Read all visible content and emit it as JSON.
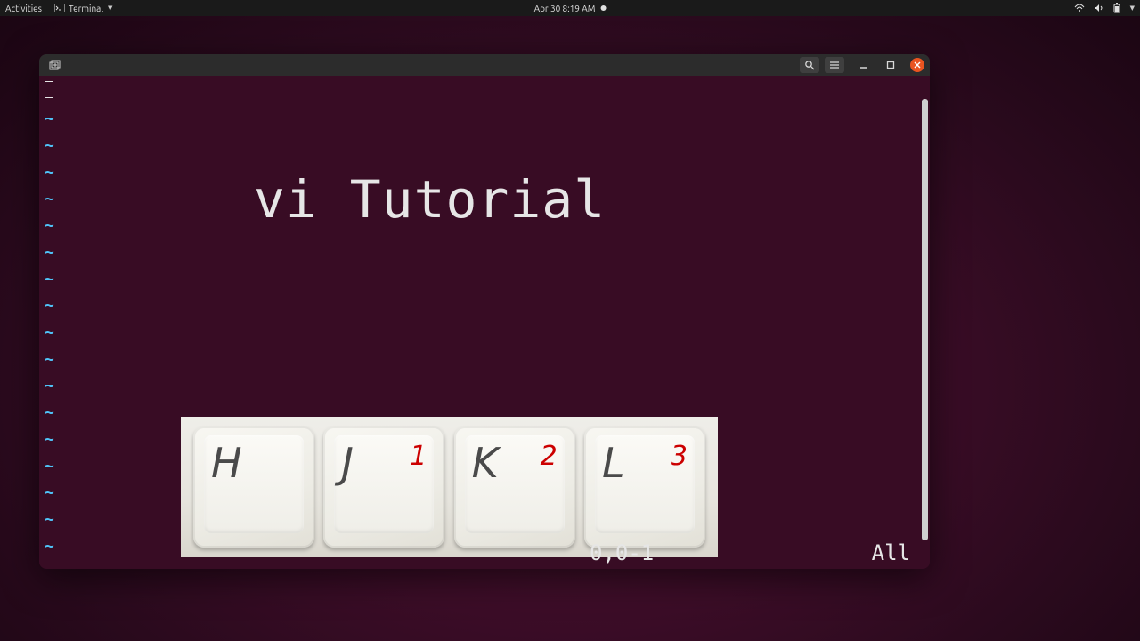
{
  "topbar": {
    "activities": "Activities",
    "app_name": "Terminal",
    "datetime": "Apr 30  8:19 AM"
  },
  "window": {
    "overlay_title": "vi Tutorial",
    "tilde": "~",
    "tilde_count": 17,
    "status_position": "0,0-1",
    "status_scope": "All",
    "keys": [
      {
        "letter": "H",
        "num": ""
      },
      {
        "letter": "J",
        "num": "1"
      },
      {
        "letter": "K",
        "num": "2"
      },
      {
        "letter": "L",
        "num": "3"
      }
    ]
  }
}
